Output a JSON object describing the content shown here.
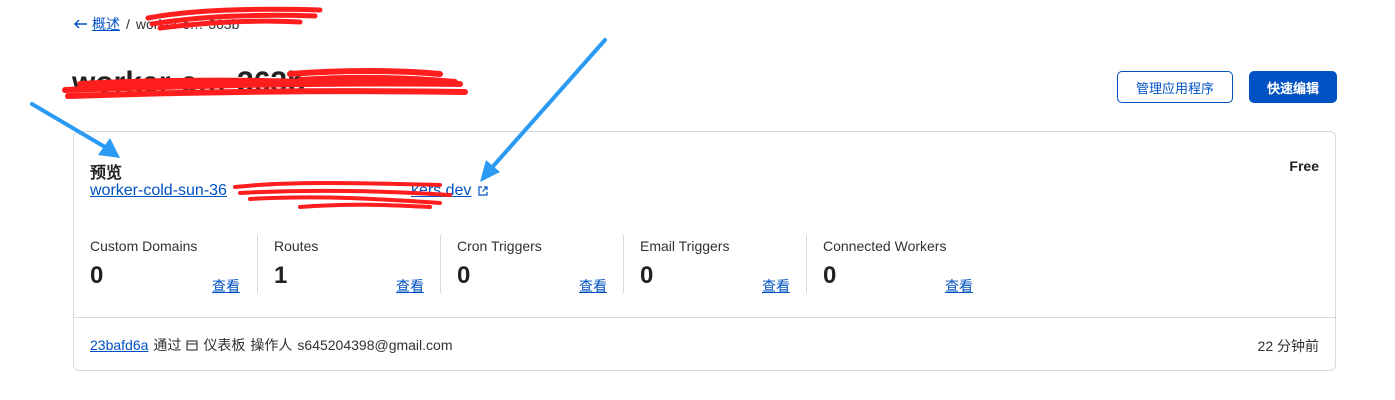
{
  "breadcrumb": {
    "back_label": "概述",
    "separator": "/",
    "current": "worker-c…-363b"
  },
  "page_title": "worker-c…-363b",
  "actions": {
    "manage_apps": "管理应用程序",
    "quick_edit": "快速编辑"
  },
  "preview": {
    "label": "预览",
    "plan": "Free",
    "url_prefix": "worker-cold-sun-36",
    "url_suffix": "kers.dev",
    "external_icon": "external-link-icon"
  },
  "stats": [
    {
      "label": "Custom Domains",
      "value": "0",
      "link": "查看"
    },
    {
      "label": "Routes",
      "value": "1",
      "link": "查看"
    },
    {
      "label": "Cron Triggers",
      "value": "0",
      "link": "查看"
    },
    {
      "label": "Email Triggers",
      "value": "0",
      "link": "查看"
    },
    {
      "label": "Connected Workers",
      "value": "0",
      "link": "查看"
    }
  ],
  "deployment": {
    "commit": "23bafd6a",
    "via": "通过",
    "source_icon": "calendar-icon",
    "source": "仪表板",
    "operator_label": "操作人",
    "operator": "s645204398@gmail.com",
    "time_ago": "22 分钟前"
  },
  "colors": {
    "link": "#0051c3",
    "primary": "#0051c3",
    "redaction": "#ff1e1e",
    "annotation_arrow": "#2b9af3"
  }
}
